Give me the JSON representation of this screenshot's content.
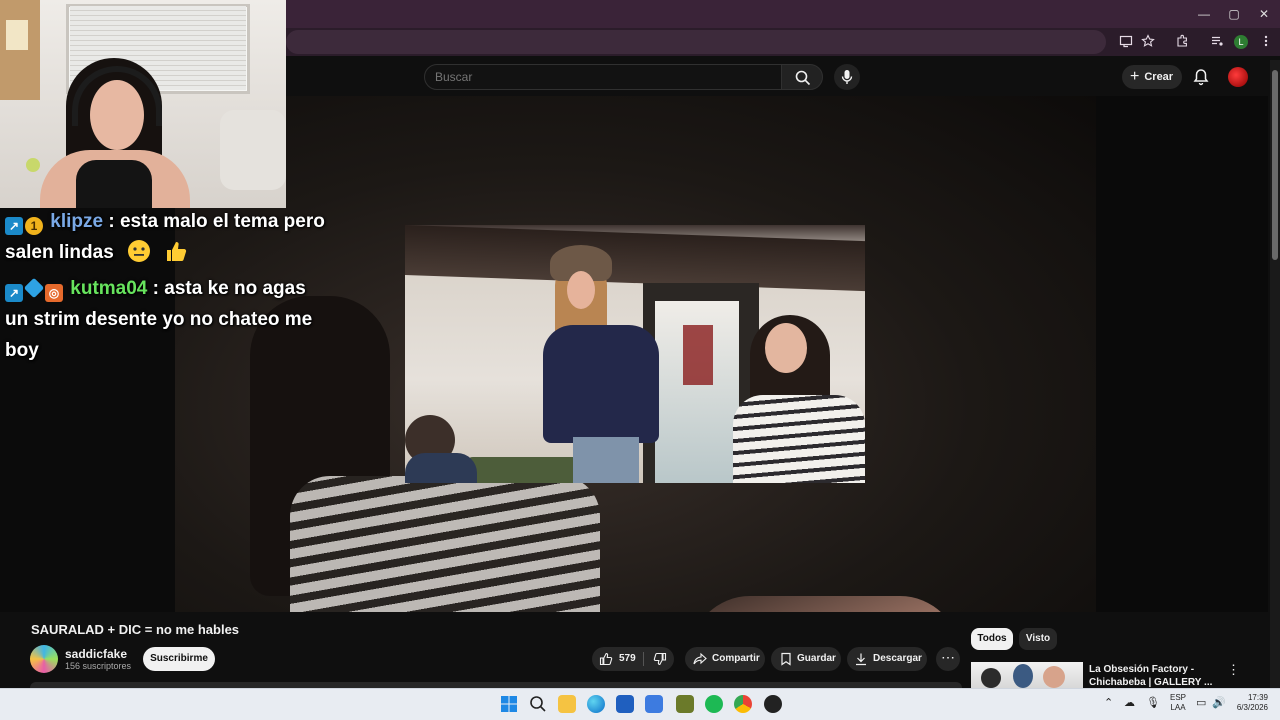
{
  "browser": {
    "window_controls": [
      "—",
      "▢",
      "✕"
    ],
    "profile_letter": "L"
  },
  "header": {
    "search_placeholder": "Buscar",
    "create_label": "Crear"
  },
  "chat": [
    {
      "user": "klipze",
      "message": " : esta malo el tema pero salen lindas"
    },
    {
      "user": "kutma04",
      "message": " : asta ke no agas un strim desente yo no chateo me boy"
    }
  ],
  "video": {
    "title": "SAURALAD + DIC = no me hables",
    "channel_name": "saddicfake",
    "subscribers": "156 suscriptores",
    "subscribe_label": "Suscribirme",
    "likes": "579",
    "share_label": "Compartir",
    "save_label": "Guardar",
    "download_label": "Descargar",
    "more_label": "⋯"
  },
  "sidebar": {
    "chips": [
      "Todos",
      "Visto"
    ],
    "recommendation_title": "La Obsesión Factory - Chichabeba | GALLERY ...",
    "menu_label": "⋮"
  },
  "taskbar": {
    "language_line1": "ESP",
    "language_line2": "LAA",
    "time": "17:39",
    "date": "6/3/2026"
  },
  "colors": {
    "accent_red": "#ff0000",
    "chat_user1": "#7aa9e6",
    "chat_user2": "#67e35d",
    "titlebar": "#3a2338"
  }
}
